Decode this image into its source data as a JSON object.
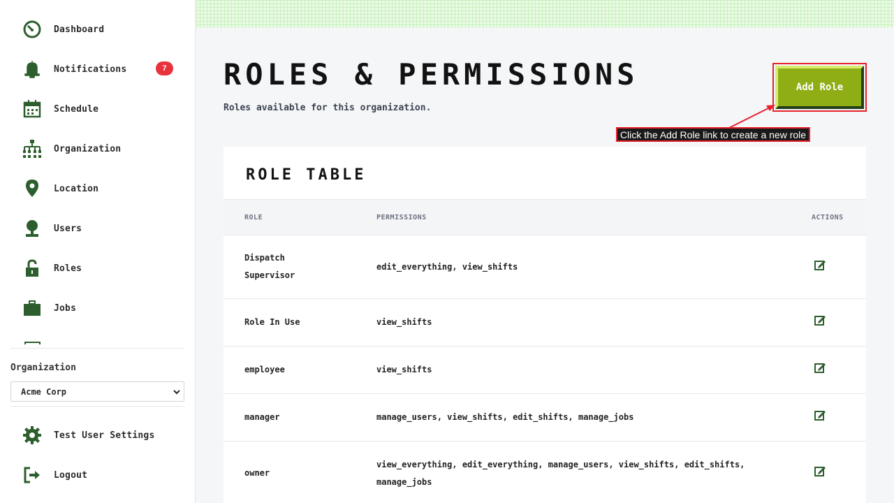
{
  "sidebar": {
    "items": [
      {
        "label": "Dashboard",
        "icon": "dashboard-icon"
      },
      {
        "label": "Notifications",
        "icon": "bell-icon",
        "badge": "7"
      },
      {
        "label": "Schedule",
        "icon": "calendar-icon"
      },
      {
        "label": "Organization",
        "icon": "org-chart-icon"
      },
      {
        "label": "Location",
        "icon": "map-pin-icon"
      },
      {
        "label": "Users",
        "icon": "user-icon"
      },
      {
        "label": "Roles",
        "icon": "unlock-icon"
      },
      {
        "label": "Jobs",
        "icon": "briefcase-icon"
      }
    ],
    "org_label": "Organization",
    "org_selected": "Acme Corp",
    "settings_label": "Test User Settings",
    "logout_label": "Logout"
  },
  "header": {
    "title": "Roles & Permissions",
    "subtitle": "Roles available for this organization.",
    "add_role_label": "Add Role",
    "callout": "Click the Add Role link to create a new role"
  },
  "table": {
    "title": "Role Table",
    "columns": {
      "role": "ROLE",
      "permissions": "PERMISSIONS",
      "actions": "ACTIONS"
    },
    "rows": [
      {
        "role": "Dispatch Supervisor",
        "permissions": "edit_everything, view_shifts"
      },
      {
        "role": "Role In Use",
        "permissions": "view_shifts"
      },
      {
        "role": "employee",
        "permissions": "view_shifts"
      },
      {
        "role": "manager",
        "permissions": "manage_users, view_shifts, edit_shifts, manage_jobs"
      },
      {
        "role": "owner",
        "permissions": "view_everything, edit_everything, manage_users, view_shifts, edit_shifts, manage_jobs"
      }
    ]
  },
  "colors": {
    "accent": "#8fae16",
    "icon_green": "#2d5e2d",
    "badge": "#e8323c",
    "highlight": "#e8202a"
  }
}
